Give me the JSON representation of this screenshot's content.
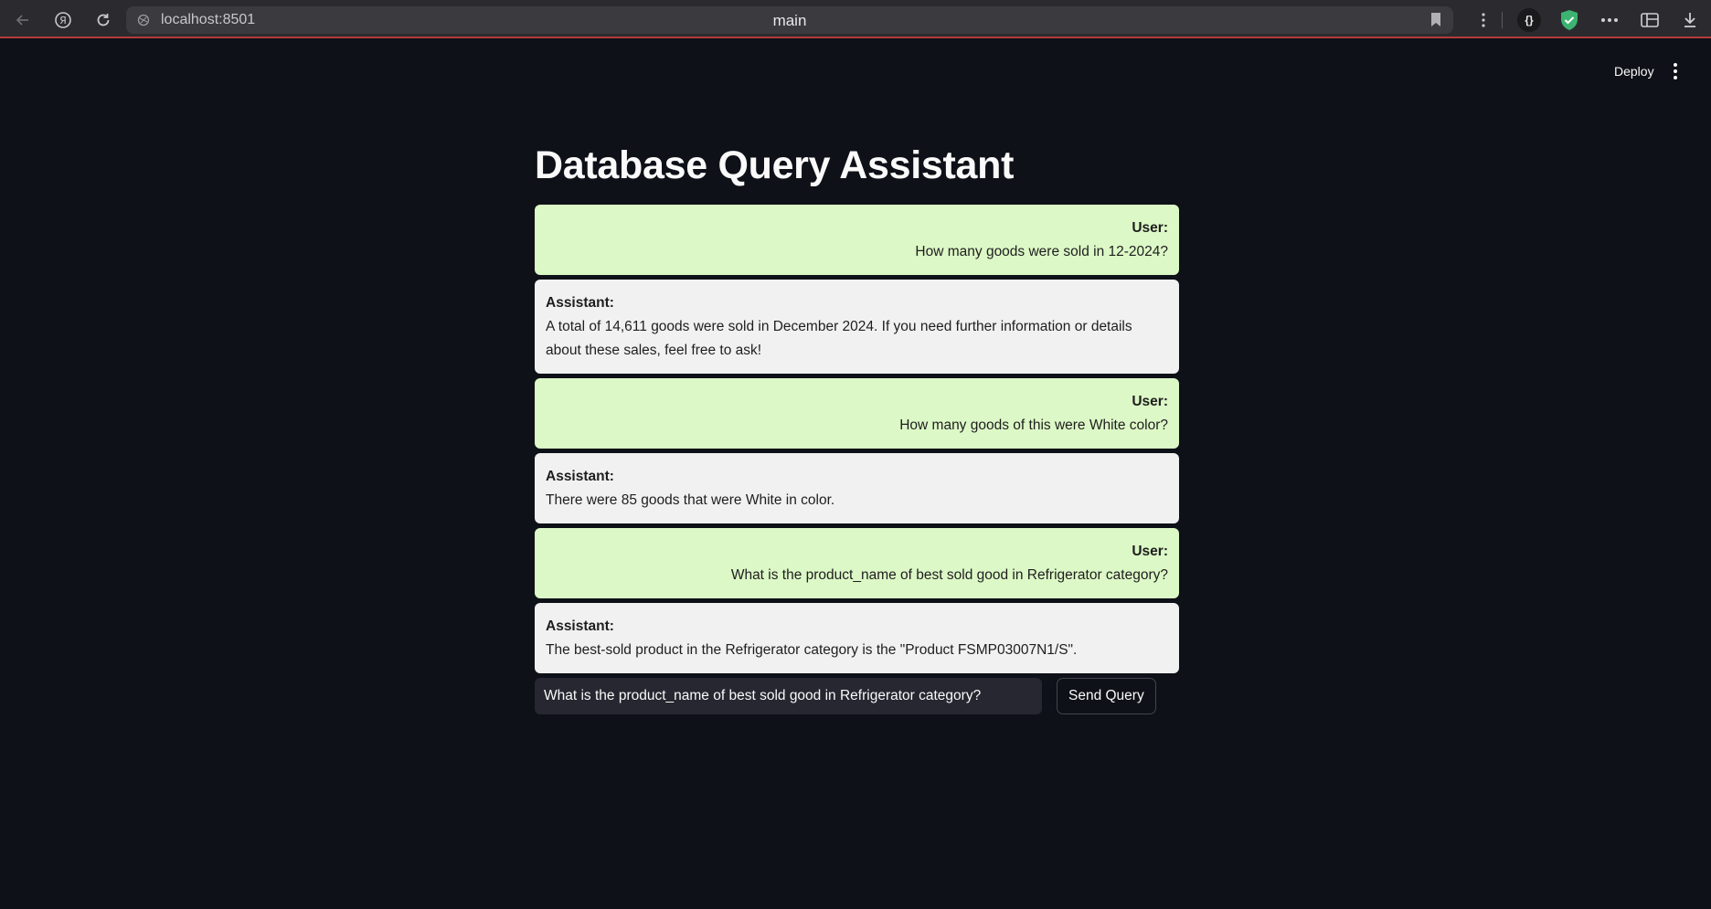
{
  "browser": {
    "url": "localhost:8501",
    "tab_title": "main",
    "icons": [
      "back-icon",
      "yandex-icon",
      "reload-icon",
      "site-info-icon",
      "bookmark-icon",
      "more-vertical-icon",
      "braces-extension-icon",
      "shield-check-icon",
      "dots-icon",
      "library-icon",
      "download-icon"
    ]
  },
  "header": {
    "deploy_label": "Deploy"
  },
  "main": {
    "title": "Database Query Assistant",
    "messages": [
      {
        "role": "user",
        "label": "User:",
        "text": "How many goods were sold in 12-2024?"
      },
      {
        "role": "assistant",
        "label": "Assistant:",
        "text": "A total of 14,611 goods were sold in December 2024. If you need further information or details about these sales, feel free to ask!"
      },
      {
        "role": "user",
        "label": "User:",
        "text": "How many goods of this were White color?"
      },
      {
        "role": "assistant",
        "label": "Assistant:",
        "text": "There were 85 goods that were White in color."
      },
      {
        "role": "user",
        "label": "User:",
        "text": "What is the product_name of best sold good in Refrigerator category?"
      },
      {
        "role": "assistant",
        "label": "Assistant:",
        "text": "The best-sold product in the Refrigerator category is the \"Product FSMP03007N1/S\"."
      }
    ],
    "input": {
      "value": "What is the product_name of best sold good in Refrigerator category?"
    },
    "send_label": "Send Query"
  },
  "colors": {
    "background": "#0e1117",
    "user_bubble": "#dcf8c6",
    "assistant_bubble": "#f1f1f1",
    "input_bg": "#262730",
    "shield_green": "#3cb371"
  }
}
